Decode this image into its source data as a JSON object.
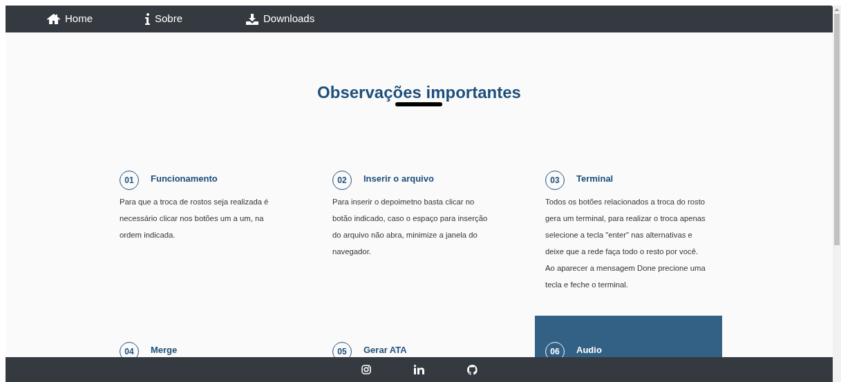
{
  "nav": [
    {
      "label": "Home",
      "kind": "home"
    },
    {
      "label": "Sobre",
      "kind": "info"
    },
    {
      "label": "Downloads",
      "kind": "download"
    }
  ],
  "heading": "Observações importantes",
  "cards": [
    {
      "number": "01",
      "title": "Funcionamento",
      "text": "Para que a troca de rostos seja realizada é necessário clicar nos botões um a um, na ordem indicada.",
      "highlighted": false
    },
    {
      "number": "02",
      "title": "Inserir o arquivo",
      "text": "Para inserir o depoimetno basta clicar no botão indicado, caso o espaço para inserção do arquivo não abra, minimize a janela do navegador.",
      "highlighted": false
    },
    {
      "number": "03",
      "title": "Terminal",
      "text": "Todos os botões relacionados a troca do rosto gera um terminal, para realizar o troca apenas selecione a tecla \"enter\" nas alternativas e deixe que a rede faça todo o resto por você. Ao aparecer a mensagem Done precione uma tecla e feche o terminal.",
      "highlighted": false
    },
    {
      "number": "04",
      "title": "Merge",
      "highlighted": false
    },
    {
      "number": "05",
      "title": "Gerar ATA",
      "highlighted": false
    },
    {
      "number": "06",
      "title": "Audio",
      "highlighted": true
    }
  ],
  "footer_links": [
    {
      "kind": "instagram"
    },
    {
      "kind": "linkedin"
    },
    {
      "kind": "github"
    }
  ]
}
